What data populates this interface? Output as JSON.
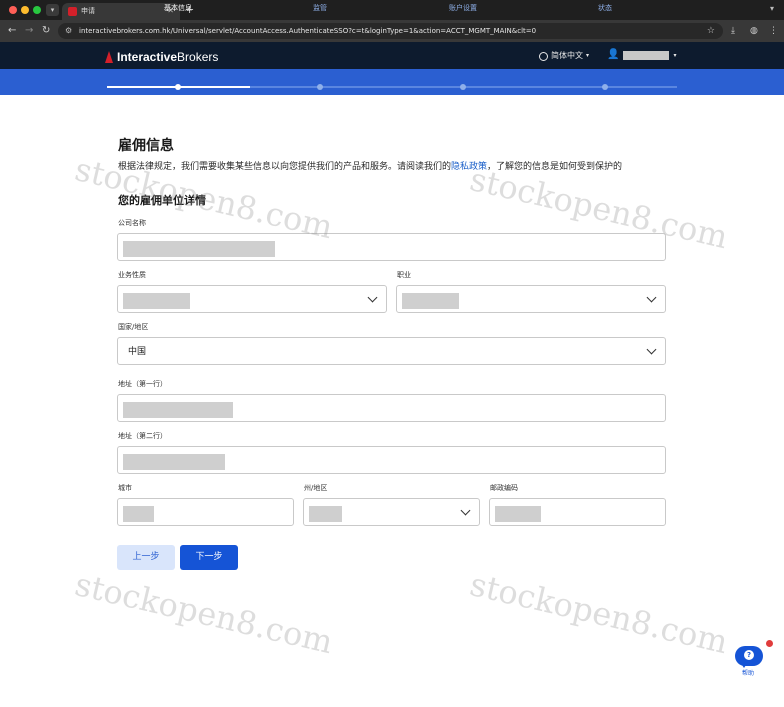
{
  "browser": {
    "tab_title": "申请",
    "tab_list_icon": "chevron-down-icon",
    "new_tab_icon": "plus-icon",
    "url": "interactivebrokers.com.hk/Universal/servlet/AccountAccess.AuthenticateSSO?c=t&loginType=1&action=ACCT_MGMT_MAIN&clt=0"
  },
  "header": {
    "logo_bold": "Interactive",
    "logo_regular": "Brokers",
    "language": "简体中文",
    "brand_color": "#d3202a",
    "header_bg": "#0d1b2e"
  },
  "steps": {
    "color": "#2b5fd1",
    "active_index": 0,
    "completed_fraction": 0.25,
    "items": [
      {
        "label": "基本信息"
      },
      {
        "label": "监管"
      },
      {
        "label": "账户设置"
      },
      {
        "label": "状态"
      }
    ]
  },
  "form": {
    "title": "雇佣信息",
    "intro_before": "根据法律规定，我们需要收集某些信息以向您提供我们的产品和服务。请阅读我们的",
    "intro_link": "隐私政策",
    "intro_after": "，了解您的信息是如何受到保护的",
    "section_title": "您的雇佣单位详情",
    "fields": {
      "company": {
        "label": "公司名称"
      },
      "business_nature": {
        "label": "业务性质"
      },
      "occupation": {
        "label": "职业"
      },
      "country": {
        "label": "国家/地区",
        "value": "中国"
      },
      "address1": {
        "label": "地址（第一行）"
      },
      "address2": {
        "label": "地址（第二行）"
      },
      "city": {
        "label": "城市"
      },
      "state": {
        "label": "州/地区"
      },
      "postal": {
        "label": "邮政编码"
      }
    },
    "prev_button": "上一步",
    "next_button": "下一步",
    "accent_color": "#1554d6"
  },
  "watermark": "stockopen8.com",
  "help": {
    "label": "帮助",
    "icon": "help-chat-icon"
  }
}
